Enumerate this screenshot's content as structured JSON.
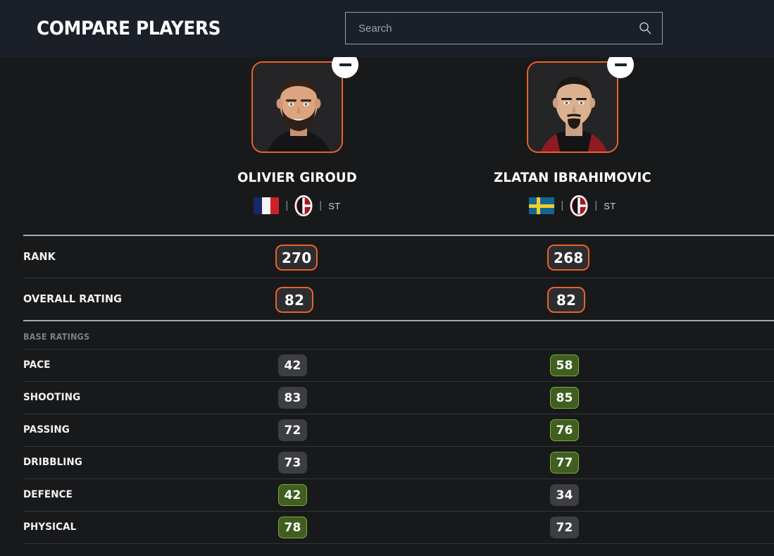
{
  "header": {
    "title": "COMPARE PLAYERS",
    "search": {
      "placeholder": "Search",
      "value": "",
      "icon": "search-icon"
    }
  },
  "colors": {
    "header_bg": "#1b1f27",
    "page_bg": "#18191b",
    "accent_orange": "#e8622a",
    "better_green_fill": "#3f5e20",
    "better_green_border": "#7cab3c",
    "neutral_pill": "#3c3e42",
    "divider_strong": "#a6a8ac",
    "divider_light": "#33353a",
    "muted_text": "#7d7f84"
  },
  "players": [
    {
      "name": "OLIVIER GIROUD",
      "nation": "France",
      "nation_flag": "france-flag",
      "club": "AC Milan",
      "club_crest": "ac-milan-crest",
      "position": "ST",
      "remove_label": "remove-player",
      "portrait": "olivier-giroud-portrait"
    },
    {
      "name": "ZLATAN IBRAHIMOVIC",
      "nation": "Sweden",
      "nation_flag": "sweden-flag",
      "club": "AC Milan",
      "club_crest": "ac-milan-crest",
      "position": "ST",
      "remove_label": "remove-player",
      "portrait": "zlatan-ibrahimovic-portrait"
    }
  ],
  "top_stats": [
    {
      "label": "RANK",
      "values": [
        "270",
        "268"
      ]
    },
    {
      "label": "OVERALL RATING",
      "values": [
        "82",
        "82"
      ]
    }
  ],
  "sections": [
    {
      "label": "BASE RATINGS",
      "rows": [
        {
          "label": "PACE",
          "values": [
            "42",
            "58"
          ],
          "better": [
            false,
            true
          ]
        },
        {
          "label": "SHOOTING",
          "values": [
            "83",
            "85"
          ],
          "better": [
            false,
            true
          ]
        },
        {
          "label": "PASSING",
          "values": [
            "72",
            "76"
          ],
          "better": [
            false,
            true
          ]
        },
        {
          "label": "DRIBBLING",
          "values": [
            "73",
            "77"
          ],
          "better": [
            false,
            true
          ]
        },
        {
          "label": "DEFENCE",
          "values": [
            "42",
            "34"
          ],
          "better": [
            true,
            false
          ]
        },
        {
          "label": "PHYSICAL",
          "values": [
            "78",
            "72"
          ],
          "better": [
            true,
            false
          ]
        }
      ]
    }
  ]
}
